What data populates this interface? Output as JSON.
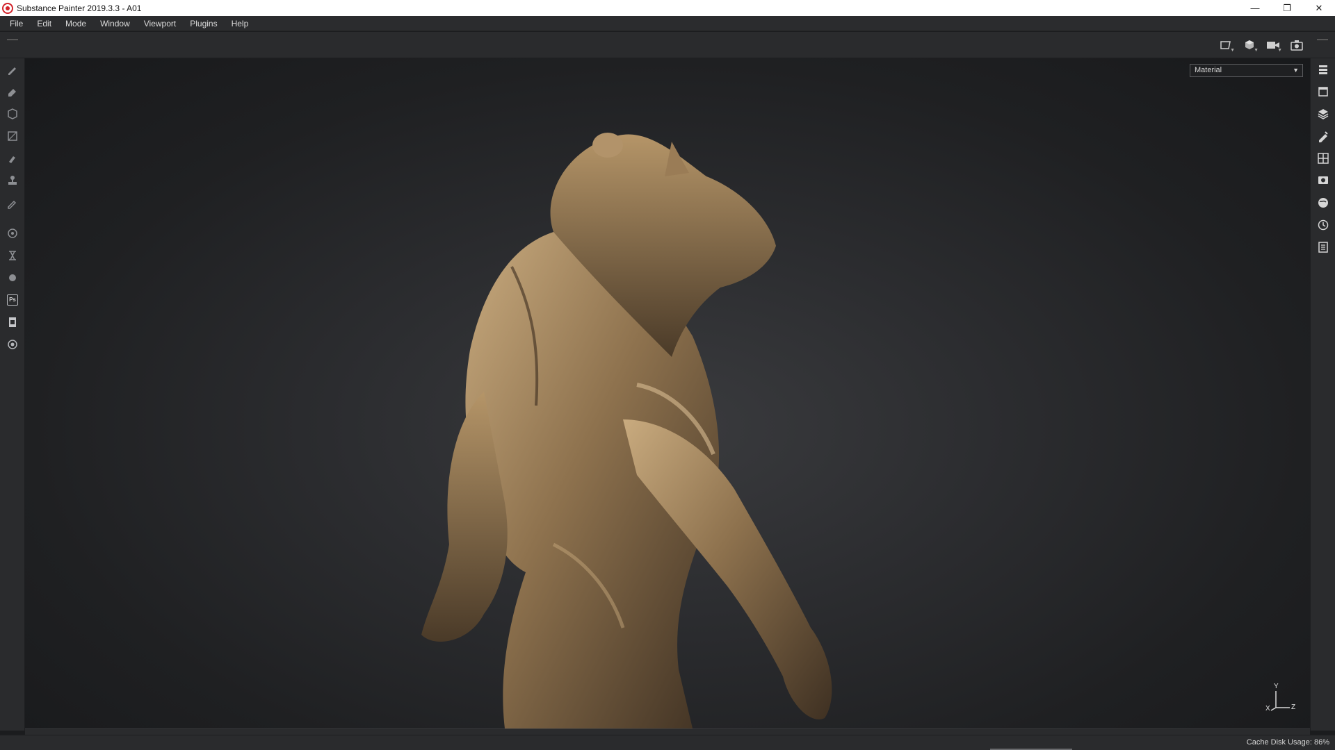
{
  "window": {
    "title": "Substance Painter 2019.3.3 - A01",
    "controls": {
      "minimize": "—",
      "restore": "❐",
      "close": "✕"
    }
  },
  "menu": {
    "items": [
      "File",
      "Edit",
      "Mode",
      "Window",
      "Viewport",
      "Plugins",
      "Help"
    ]
  },
  "left_tools": [
    {
      "name": "paint-brush-icon"
    },
    {
      "name": "eraser-icon"
    },
    {
      "name": "projection-icon"
    },
    {
      "name": "polygon-fill-icon"
    },
    {
      "name": "smudge-icon"
    },
    {
      "name": "clone-stamp-icon"
    },
    {
      "name": "color-picker-icon"
    },
    {
      "name": "bake-settings-icon"
    },
    {
      "name": "iray-render-icon"
    },
    {
      "name": "shader-settings-icon"
    },
    {
      "name": "photoshop-export-icon",
      "badge": "Ps"
    },
    {
      "name": "export-document-icon"
    },
    {
      "name": "plugin-settings-icon"
    }
  ],
  "right_tools": [
    {
      "name": "texture-set-list-icon"
    },
    {
      "name": "texture-set-settings-icon"
    },
    {
      "name": "layers-icon"
    },
    {
      "name": "properties-icon"
    },
    {
      "name": "shelf-icon"
    },
    {
      "name": "display-settings-icon"
    },
    {
      "name": "environment-icon"
    },
    {
      "name": "history-icon"
    },
    {
      "name": "log-icon"
    }
  ],
  "viewport": {
    "channel_select": "Material",
    "gizmo": {
      "y": "Y",
      "x": "X",
      "z": "Z"
    }
  },
  "status": {
    "cache_disk_usage": "Cache Disk Usage:   86%"
  },
  "colors": {
    "accent_red": "#d2222a",
    "bronze": "#a88a62"
  }
}
